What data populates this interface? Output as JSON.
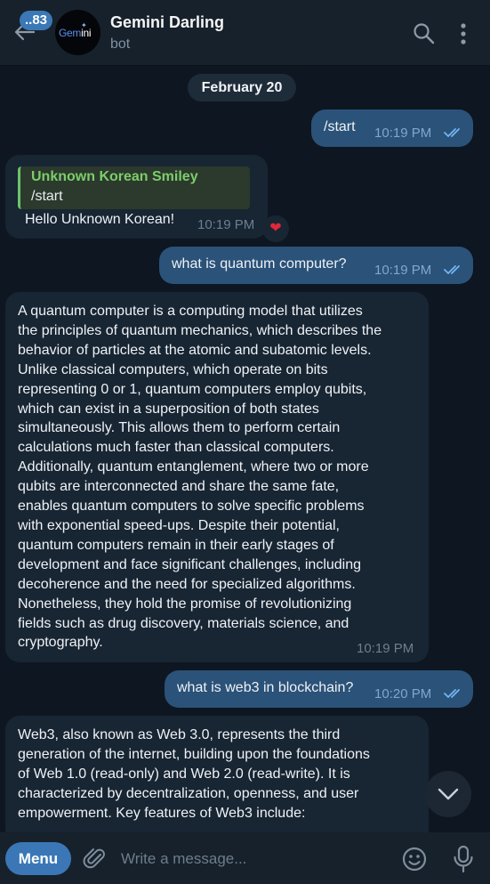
{
  "header": {
    "back_icon": "arrow-left-icon",
    "unread_count": "..83",
    "avatar_text_g": "Gem",
    "avatar_text_rest": "ini",
    "title": "Gemini Darling",
    "status": "bot",
    "search_icon": "search-icon",
    "more_icon": "more-vertical-icon"
  },
  "date_separator": "February 20",
  "messages": [
    {
      "direction": "outgoing",
      "text": "/start",
      "time": "10:19 PM",
      "status": "read"
    },
    {
      "direction": "incoming",
      "reply_to": {
        "name": "Unknown Korean Smiley",
        "text": "/start"
      },
      "text": "Hello Unknown Korean!",
      "time": "10:19 PM",
      "reaction": "❤"
    },
    {
      "direction": "outgoing",
      "text": "what is quantum computer?",
      "time": "10:19 PM",
      "status": "read"
    },
    {
      "direction": "incoming",
      "lines": [
        "A quantum computer is a computing model that utilizes",
        "the principles of quantum mechanics, which describes the",
        "behavior of particles at the atomic and subatomic levels.",
        "Unlike classical computers, which operate on bits",
        "representing 0 or 1, quantum computers employ qubits,",
        "which can exist in a superposition of both states",
        "simultaneously. This allows them to perform certain",
        "calculations much faster than classical computers.",
        "Additionally, quantum entanglement, where two or more",
        "qubits are interconnected and share the same fate,",
        "enables quantum computers to solve specific problems",
        "with exponential speed-ups. Despite their potential,",
        "quantum computers remain in their early stages of",
        "development and face significant challenges, including",
        "decoherence and the need for specialized algorithms.",
        "Nonetheless, they hold the promise of revolutionizing",
        "fields such as drug discovery, materials science, and",
        "cryptography."
      ],
      "time": "10:19 PM"
    },
    {
      "direction": "outgoing",
      "text": "what is web3 in blockchain?",
      "time": "10:20 PM",
      "status": "read"
    },
    {
      "direction": "incoming",
      "lines": [
        "Web3, also known as Web 3.0, represents the third",
        "generation of the internet, building upon the foundations",
        "of Web 1.0 (read-only) and Web 2.0 (read-write). It is",
        "characterized by decentralization, openness, and user",
        "empowerment. Key features of Web3 include:"
      ]
    }
  ],
  "scroll_down_icon": "chevron-down-icon",
  "composer": {
    "menu_label": "Menu",
    "attach_icon": "paperclip-icon",
    "placeholder": "Write a message...",
    "emoji_icon": "emoji-icon",
    "mic_icon": "microphone-icon"
  },
  "colors": {
    "background": "#0e1621",
    "header": "#17212b",
    "outgoing_bubble": "#2b5278",
    "incoming_bubble": "#182533",
    "accent": "#3b77b6",
    "reply_name": "#7ccd6c"
  }
}
